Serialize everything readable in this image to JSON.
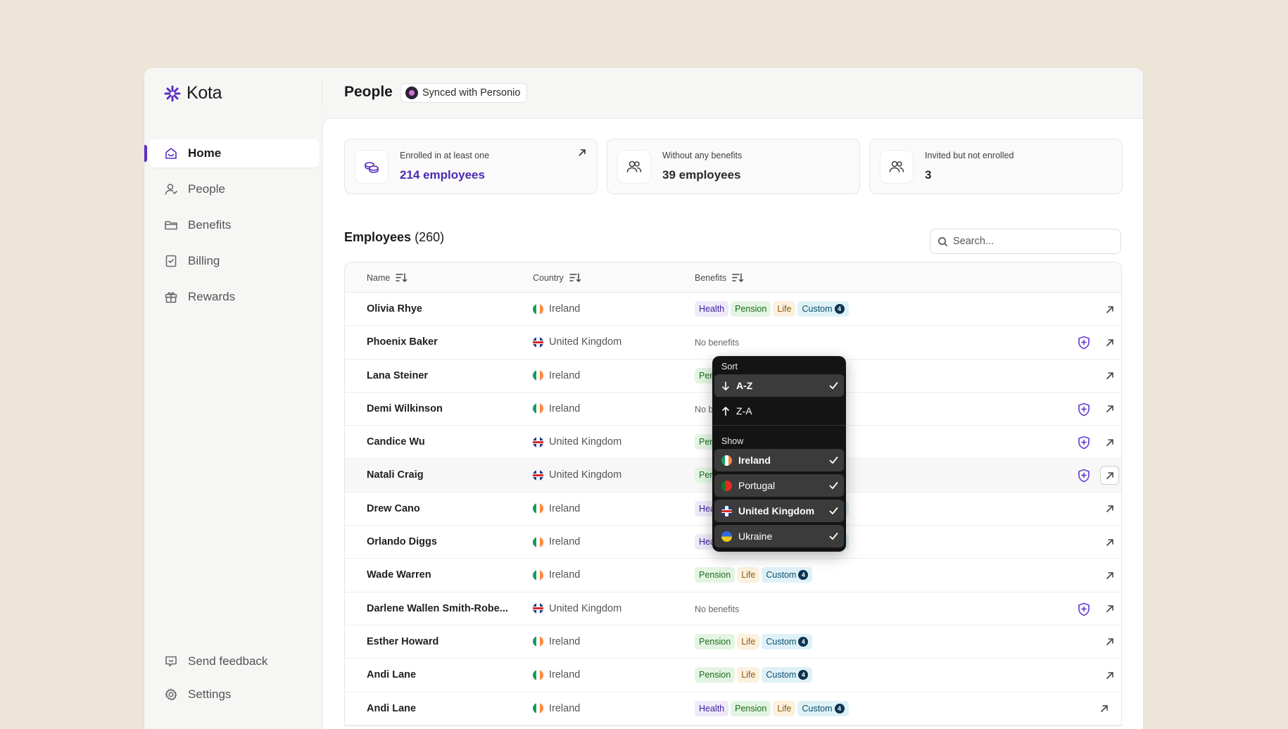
{
  "app": {
    "name": "Kota"
  },
  "header": {
    "title": "People",
    "sync_label": "Synced with Personio"
  },
  "sidebar": {
    "items": [
      {
        "label": "Home",
        "icon": "home-icon",
        "active": true
      },
      {
        "label": "People",
        "icon": "user-icon",
        "active": false
      },
      {
        "label": "Benefits",
        "icon": "folder-icon",
        "active": false
      },
      {
        "label": "Billing",
        "icon": "billing-icon",
        "active": false
      },
      {
        "label": "Rewards",
        "icon": "gift-icon",
        "active": false
      }
    ],
    "bottom": [
      {
        "label": "Send feedback",
        "icon": "feedback-icon"
      },
      {
        "label": "Settings",
        "icon": "gear-icon"
      }
    ]
  },
  "stats": [
    {
      "label": "Enrolled in at least one",
      "value": "214 employees",
      "icon": "coins-icon"
    },
    {
      "label": "Without any benefits",
      "value": "39 employees",
      "icon": "users-icon"
    },
    {
      "label": "Invited but not enrolled",
      "value": "3",
      "icon": "users-icon"
    }
  ],
  "employees": {
    "title": "Employees",
    "count": "(260)",
    "search_placeholder": "Search...",
    "columns": {
      "name": "Name",
      "country": "Country",
      "benefits": "Benefits"
    },
    "rows": [
      {
        "name": "Olivia Rhye",
        "country": "Ireland",
        "flag": "ie",
        "benefits": [
          "Health",
          "Pension",
          "Life",
          "Custom"
        ],
        "custom_count": "4",
        "shield": false
      },
      {
        "name": "Phoenix Baker",
        "country": "United Kingdom",
        "flag": "uk",
        "benefits": [],
        "shield": true
      },
      {
        "name": "Lana Steiner",
        "country": "Ireland",
        "flag": "ie",
        "benefits": [
          "Pension",
          "Life"
        ],
        "shield": false
      },
      {
        "name": "Demi Wilkinson",
        "country": "Ireland",
        "flag": "ie",
        "benefits": [],
        "shield": true
      },
      {
        "name": "Candice Wu",
        "country": "United Kingdom",
        "flag": "uk",
        "benefits": [
          "Pension"
        ],
        "shield": true
      },
      {
        "name": "Natali Craig",
        "country": "United Kingdom",
        "flag": "uk",
        "benefits": [
          "Pension"
        ],
        "shield": true
      },
      {
        "name": "Drew Cano",
        "country": "Ireland",
        "flag": "ie",
        "benefits": [
          "Health",
          "Pension",
          "Life",
          "Custom"
        ],
        "custom_count": "4",
        "shield": false
      },
      {
        "name": "Orlando Diggs",
        "country": "Ireland",
        "flag": "ie",
        "benefits": [
          "Health",
          "Pension",
          "Life",
          "Custom"
        ],
        "custom_count": "4",
        "shield": false
      },
      {
        "name": "Wade Warren",
        "country": "Ireland",
        "flag": "ie",
        "benefits": [
          "Pension",
          "Life",
          "Custom"
        ],
        "custom_count": "4",
        "shield": false
      },
      {
        "name": "Darlene Wallen Smith-Robe...",
        "country": "United Kingdom",
        "flag": "uk",
        "benefits": [],
        "shield": true
      },
      {
        "name": "Esther Howard",
        "country": "Ireland",
        "flag": "ie",
        "benefits": [
          "Pension",
          "Life",
          "Custom"
        ],
        "custom_count": "4",
        "shield": false
      },
      {
        "name": "Andi Lane",
        "country": "Ireland",
        "flag": "ie",
        "benefits": [
          "Pension",
          "Life",
          "Custom"
        ],
        "custom_count": "4",
        "shield": false
      },
      {
        "name": "Andi Lane",
        "country": "Ireland",
        "flag": "ie",
        "benefits": [
          "Health",
          "Pension",
          "Life",
          "Custom"
        ],
        "custom_count": "4",
        "shield": false
      }
    ],
    "no_benefits_label": "No benefits"
  },
  "dropdown": {
    "sort_label": "Sort",
    "sort_options": [
      {
        "label": "A-Z",
        "direction": "down",
        "selected": true
      },
      {
        "label": "Z-A",
        "direction": "up",
        "selected": false
      }
    ],
    "show_label": "Show",
    "show_options": [
      {
        "label": "Ireland",
        "flag": "ie",
        "checked": true
      },
      {
        "label": "Portugal",
        "flag": "pt",
        "checked": true
      },
      {
        "label": "United Kingdom",
        "flag": "uk",
        "checked": true
      },
      {
        "label": "Ukraine",
        "flag": "ua",
        "checked": true
      }
    ]
  },
  "colors": {
    "accent": "#5b2ec4",
    "background": "#ede6d8"
  }
}
